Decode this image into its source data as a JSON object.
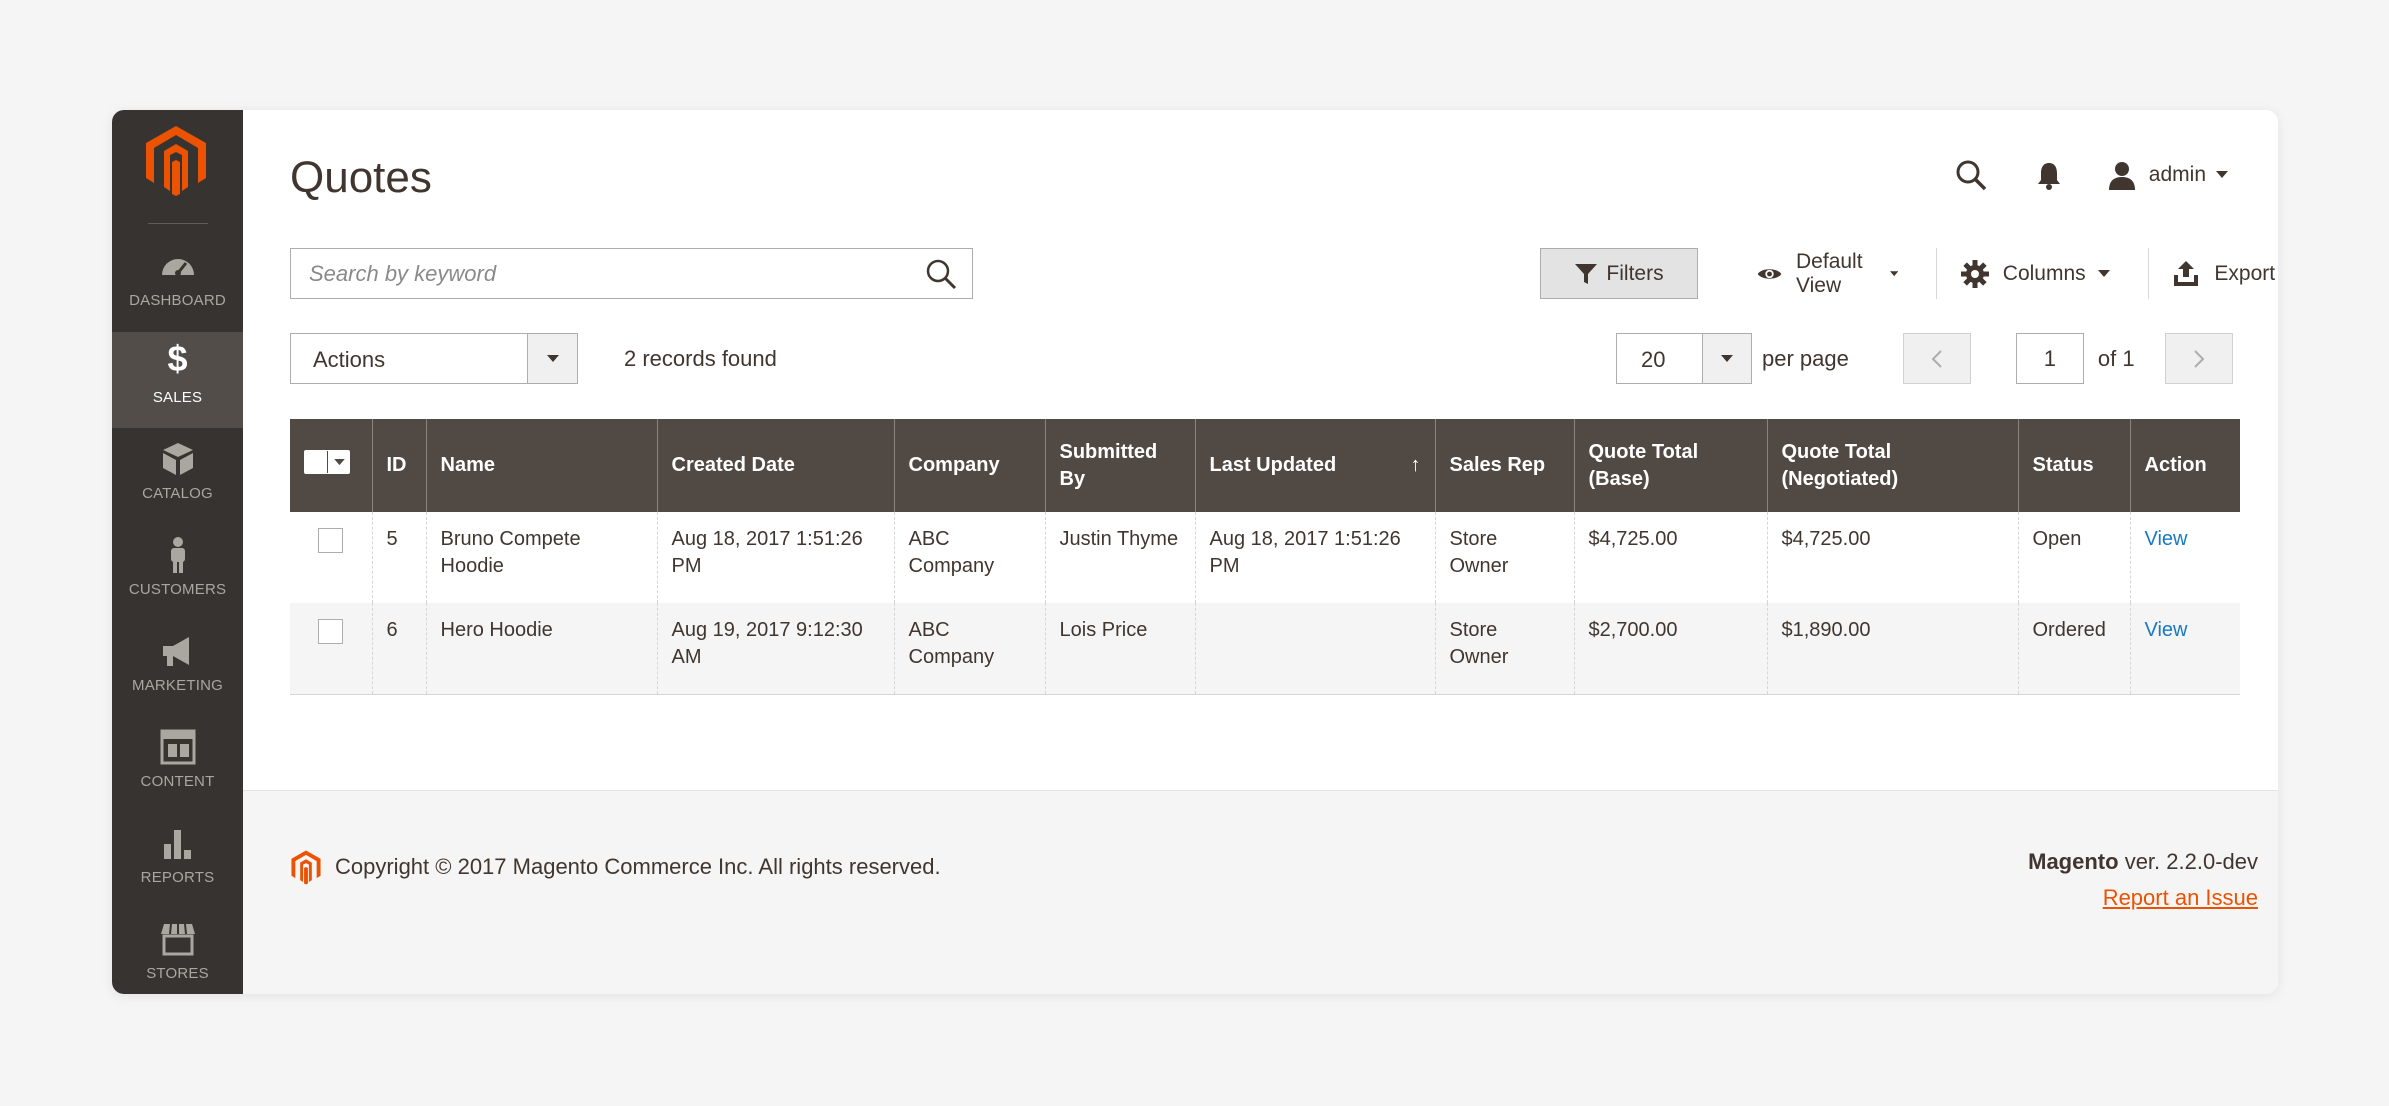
{
  "sidebar": {
    "logo": "magento-logo",
    "items": [
      {
        "label": "DASHBOARD",
        "icon": "dashboard-icon"
      },
      {
        "label": "SALES",
        "icon": "dollar-icon"
      },
      {
        "label": "CATALOG",
        "icon": "box-icon"
      },
      {
        "label": "CUSTOMERS",
        "icon": "person-icon"
      },
      {
        "label": "MARKETING",
        "icon": "megaphone-icon"
      },
      {
        "label": "CONTENT",
        "icon": "layout-icon"
      },
      {
        "label": "REPORTS",
        "icon": "bar-chart-icon"
      },
      {
        "label": "STORES",
        "icon": "store-icon"
      }
    ],
    "active": "SALES"
  },
  "header": {
    "title": "Quotes",
    "user": "admin"
  },
  "toolbar": {
    "search_placeholder": "Search by keyword",
    "filters_label": "Filters",
    "view_label": "Default View",
    "columns_label": "Columns",
    "export_label": "Export",
    "actions_label": "Actions",
    "records_found": "2 records found",
    "per_page_value": "20",
    "per_page_label": "per page",
    "page_current": "1",
    "page_total": "of 1"
  },
  "table": {
    "columns": [
      "ID",
      "Name",
      "Created Date",
      "Company",
      "Submitted By",
      "Last Updated",
      "Sales Rep",
      "Quote Total (Base)",
      "Quote Total (Negotiated)",
      "Status",
      "Action"
    ],
    "sort_indicator": "↑",
    "rows": [
      {
        "id": "5",
        "name": "Bruno Compete Hoodie",
        "created": "Aug 18, 2017 1:51:26 PM",
        "company": "ABC Company",
        "submitted_by": "Justin Thyme",
        "last_updated": "Aug 18, 2017 1:51:26 PM",
        "sales_rep": "Store Owner",
        "total_base": "$4,725.00",
        "total_negotiated": "$4,725.00",
        "status": "Open",
        "action": "View"
      },
      {
        "id": "6",
        "name": "Hero Hoodie",
        "created": "Aug 19, 2017 9:12:30 AM",
        "company": "ABC Company",
        "submitted_by": "Lois Price",
        "last_updated": "",
        "sales_rep": "Store Owner",
        "total_base": "$2,700.00",
        "total_negotiated": "$1,890.00",
        "status": "Ordered",
        "action": "View"
      }
    ]
  },
  "footer": {
    "copyright": "Copyright © 2017 Magento Commerce Inc. All rights reserved.",
    "brand": "Magento",
    "version": " ver. 2.2.0-dev",
    "report_link": "Report an Issue"
  },
  "colors": {
    "sidebar_bg": "#373330",
    "sidebar_active": "#524d49",
    "table_header": "#514943",
    "brand_orange": "#eb5202",
    "link_blue": "#1979c3"
  }
}
